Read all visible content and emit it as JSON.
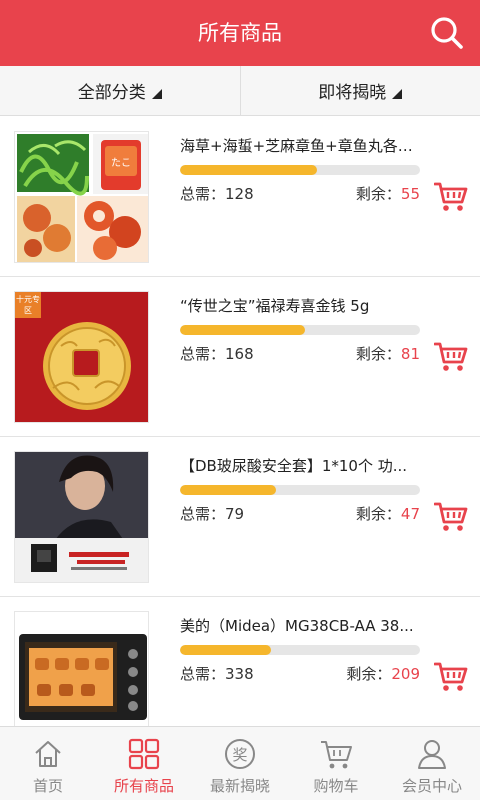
{
  "header": {
    "title": "所有商品",
    "search_icon": "search-icon"
  },
  "filters": {
    "category_label": "全部分类",
    "sort_label": "即将揭晓"
  },
  "labels": {
    "total": "总需：",
    "remaining": "剩余："
  },
  "items": [
    {
      "title": "海草+海蜇+芝麻章鱼+章鱼丸各1...",
      "progress": 0.57,
      "total": "128",
      "remaining": "55",
      "image": "seafood-photo",
      "tag": ""
    },
    {
      "title": "“传世之宝”福禄寿喜金钱 5g",
      "progress": 0.52,
      "total": "168",
      "remaining": "81",
      "image": "gold-coin-photo",
      "tag": "十元专区"
    },
    {
      "title": "【DB玻尿酸安全套】1*10个 功...",
      "progress": 0.4,
      "total": "79",
      "remaining": "47",
      "image": "model-product-photo",
      "tag": ""
    },
    {
      "title": "美的（Midea）MG38CB-AA 38...",
      "progress": 0.38,
      "total": "338",
      "remaining": "209",
      "image": "oven-photo",
      "tag": ""
    }
  ],
  "tabbar": {
    "home": "首页",
    "all_products": "所有商品",
    "latest": "最新揭晓",
    "cart": "购物车",
    "member": "会员中心",
    "active": "all_products"
  },
  "colors": {
    "brand_red": "#e8434c",
    "progress_yellow": "#f5b62c",
    "tag_orange": "#e98028"
  }
}
